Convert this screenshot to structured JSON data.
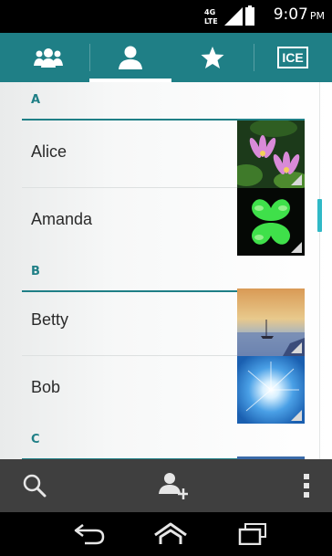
{
  "status_bar": {
    "network_type": "4G LTE",
    "time": "9:07",
    "ampm": "PM"
  },
  "tabs": [
    {
      "id": "groups",
      "icon": "groups-icon",
      "selected": false
    },
    {
      "id": "contacts",
      "icon": "person-icon",
      "selected": true
    },
    {
      "id": "favorites",
      "icon": "star-icon",
      "selected": false
    },
    {
      "id": "ice",
      "icon": "ice-icon",
      "label": "ICE",
      "selected": false
    }
  ],
  "sections": [
    {
      "letter": "A",
      "contacts": [
        {
          "name": "Alice",
          "photo": "lotus-flowers"
        },
        {
          "name": "Amanda",
          "photo": "green-clover"
        }
      ]
    },
    {
      "letter": "B",
      "contacts": [
        {
          "name": "Betty",
          "photo": "sunset-sailboat"
        },
        {
          "name": "Bob",
          "photo": "sun-sky"
        }
      ]
    },
    {
      "letter": "C",
      "contacts": []
    }
  ],
  "action_bar": [
    {
      "id": "search",
      "icon": "search-icon"
    },
    {
      "id": "add-contact",
      "icon": "add-contact-icon"
    },
    {
      "id": "overflow",
      "icon": "overflow-menu-icon"
    }
  ],
  "nav_bar": [
    {
      "id": "back",
      "icon": "back-icon"
    },
    {
      "id": "home",
      "icon": "home-icon"
    },
    {
      "id": "recents",
      "icon": "recents-icon"
    }
  ],
  "colors": {
    "accent": "#1f7f86",
    "scroll_thumb": "#30b9c6",
    "action_bar": "#3f3f3f"
  }
}
